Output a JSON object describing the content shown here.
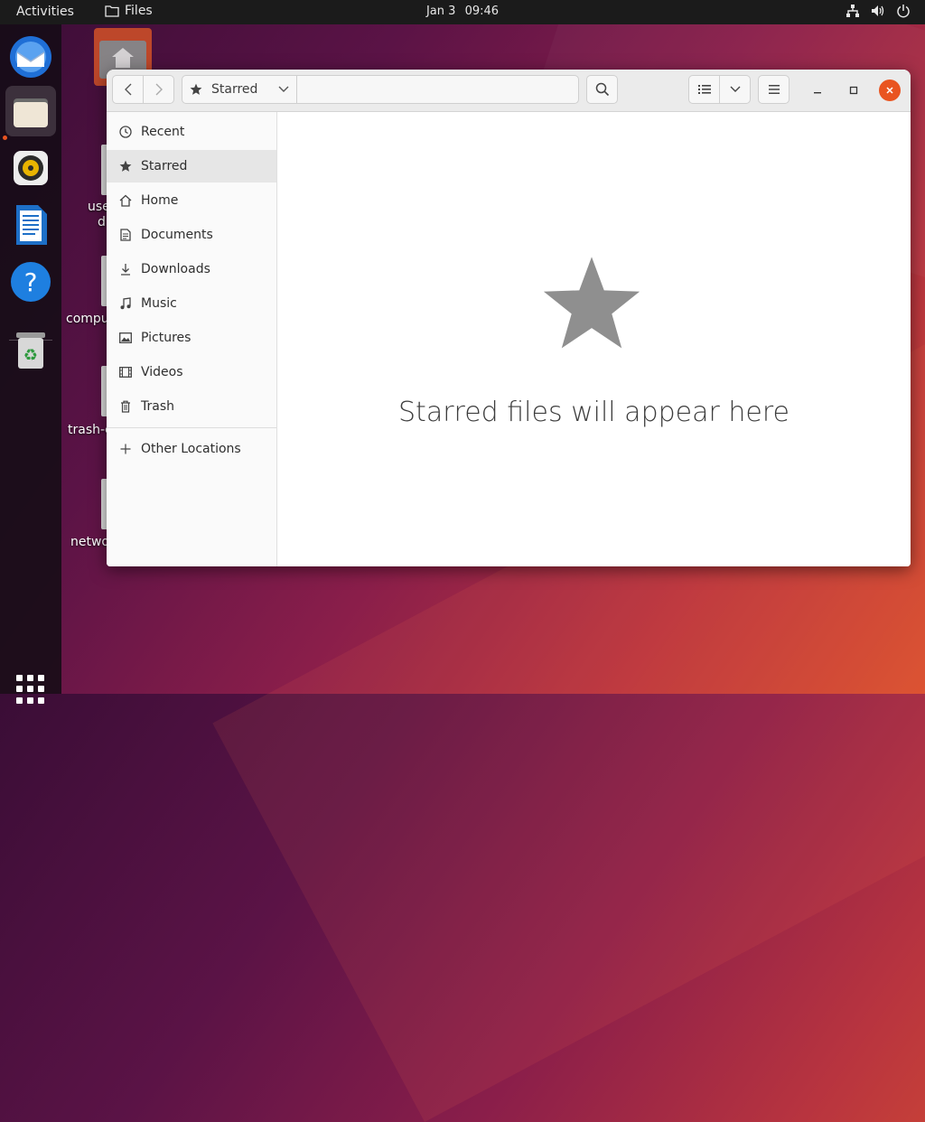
{
  "topbar": {
    "activities": "Activities",
    "app_name": "Files",
    "date": "Jan 3",
    "time": "09:46"
  },
  "dock": {
    "items": [
      "thunderbird-icon",
      "files-icon",
      "rhythmbox-icon",
      "libreoffice-writer-icon",
      "help-icon",
      "trash-icon"
    ],
    "accent": "#e95420"
  },
  "desktop": {
    "labels": [
      "use",
      "d",
      "compu",
      "trash-c",
      "netwo"
    ]
  },
  "window": {
    "path_label": "Starred",
    "sidebar": {
      "items": [
        {
          "label": "Recent",
          "icon": "clock-icon"
        },
        {
          "label": "Starred",
          "icon": "star-icon"
        },
        {
          "label": "Home",
          "icon": "home-icon"
        },
        {
          "label": "Documents",
          "icon": "document-icon"
        },
        {
          "label": "Downloads",
          "icon": "download-icon"
        },
        {
          "label": "Music",
          "icon": "music-icon"
        },
        {
          "label": "Pictures",
          "icon": "picture-icon"
        },
        {
          "label": "Videos",
          "icon": "video-icon"
        },
        {
          "label": "Trash",
          "icon": "trash-icon"
        }
      ],
      "other": {
        "label": "Other Locations",
        "icon": "plus-icon"
      }
    },
    "empty_message": "Starred files will appear here"
  }
}
